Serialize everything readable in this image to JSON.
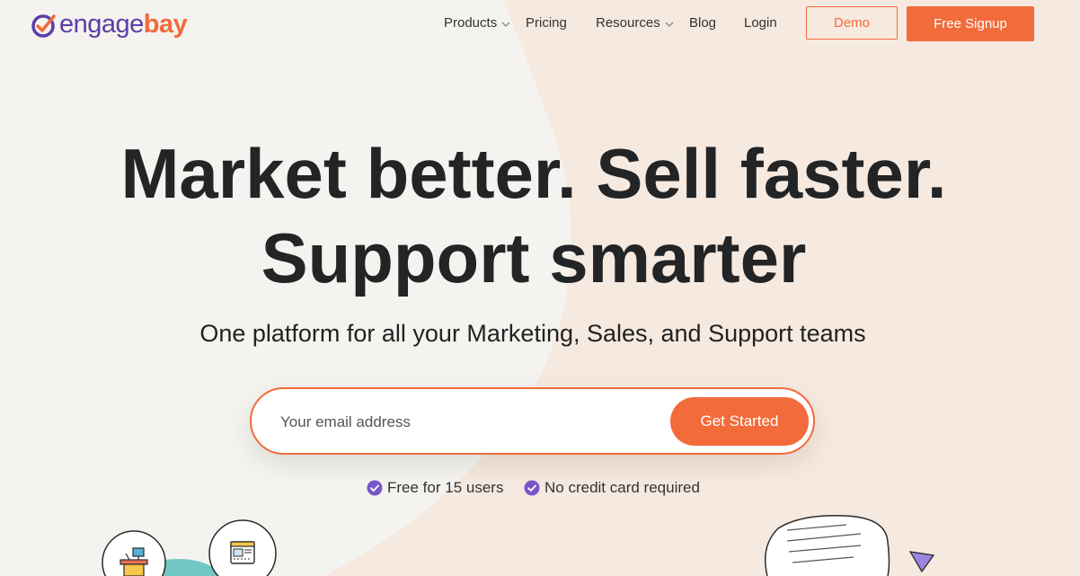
{
  "brand": {
    "logo_part1": "engage",
    "logo_part2": "bay",
    "colors": {
      "primary_orange": "#f26b3a",
      "brand_purple": "#5b3ea8",
      "check_purple": "#7a55c7",
      "text_dark": "#222426"
    }
  },
  "nav": {
    "items": [
      {
        "label": "Products",
        "has_dropdown": true
      },
      {
        "label": "Pricing",
        "has_dropdown": false
      },
      {
        "label": "Resources",
        "has_dropdown": true
      },
      {
        "label": "Blog",
        "has_dropdown": false
      },
      {
        "label": "Login",
        "has_dropdown": false
      }
    ],
    "demo_label": "Demo",
    "signup_label": "Free Signup"
  },
  "hero": {
    "title_line1": "Market better. Sell faster.",
    "title_line2": "Support smarter",
    "subtitle": "One platform for all your Marketing, Sales, and Support teams",
    "email_placeholder": "Your email address",
    "cta_label": "Get Started",
    "perks": [
      {
        "label": "Free for 15 users",
        "icon": "check-circle-icon"
      },
      {
        "label": "No credit card required",
        "icon": "check-circle-icon"
      }
    ]
  },
  "illustrations": {
    "left_icons": [
      "desk-icon",
      "browser-window-icon"
    ],
    "right_icons": [
      "speech-bubble-icon",
      "triangle-icon"
    ]
  }
}
